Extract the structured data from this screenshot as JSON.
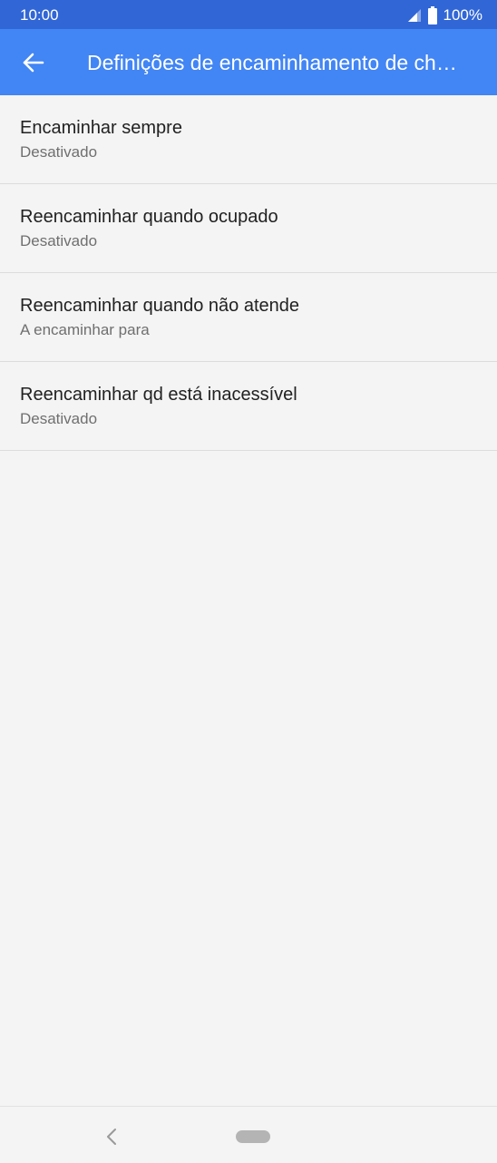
{
  "status_bar": {
    "time": "10:00",
    "battery": "100%",
    "icons": [
      "signal-icon",
      "battery-icon"
    ]
  },
  "app_bar": {
    "back_icon": "back-arrow-icon",
    "title": "Definições de encaminhamento de chamadas"
  },
  "list": {
    "items": [
      {
        "title": "Encaminhar sempre",
        "summary": "Desativado"
      },
      {
        "title": "Reencaminhar quando ocupado",
        "summary": "Desativado"
      },
      {
        "title": "Reencaminhar quando não atende",
        "summary": "A encaminhar para"
      },
      {
        "title": "Reencaminhar qd está inacessível",
        "summary": "Desativado"
      }
    ]
  },
  "nav_bar": {
    "icons": [
      "nav-back-icon",
      "nav-home-pill"
    ]
  },
  "colors": {
    "status_bar": "#3166d6",
    "app_bar": "#4285f4",
    "background": "#f4f4f4",
    "divider": "#dcdcdc"
  }
}
